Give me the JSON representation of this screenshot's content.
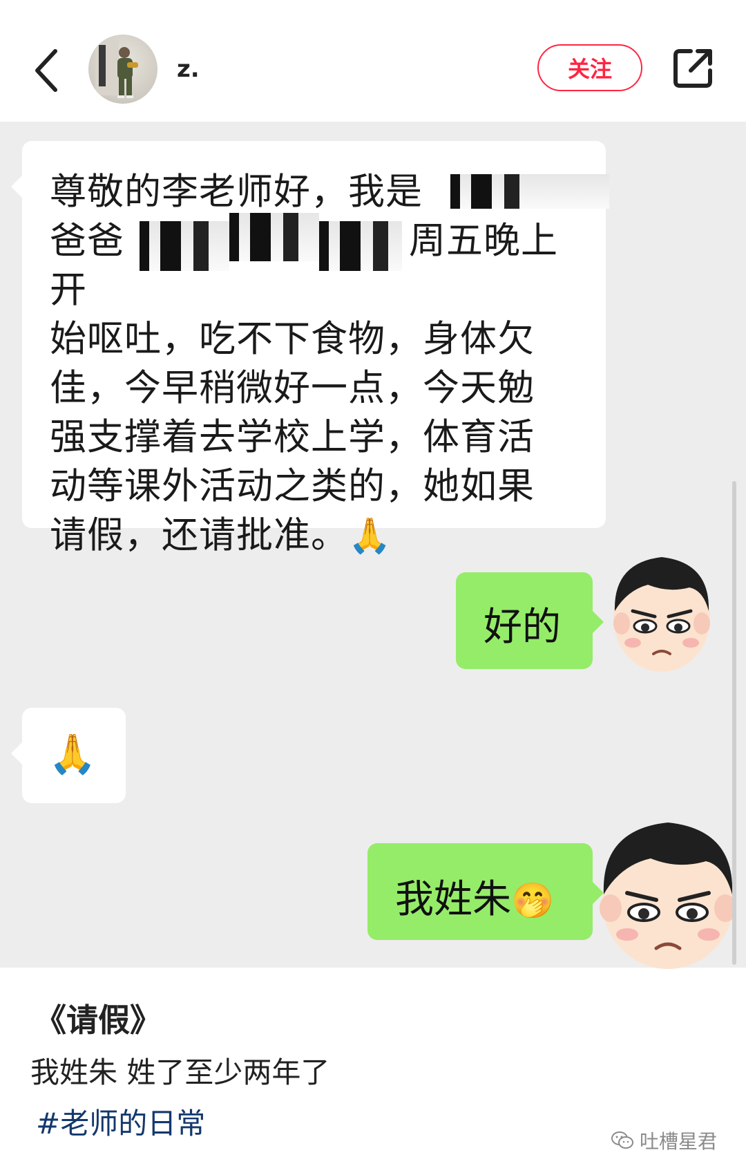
{
  "header": {
    "username": "z.",
    "follow_label": "关注"
  },
  "messages": {
    "m1": {
      "line1": "尊敬的李老师好，我是",
      "line2_prefix": "爸爸",
      "line2_suffix": "周五晚上开",
      "line3": "始呕吐，吃不下食物，身体欠",
      "line4": "佳，今早稍微好一点，今天勉",
      "line5": "强支撑着去学校上学，体育活",
      "line6": "动等课外活动之类的，她如果",
      "line7": "请假，还请批准。",
      "emoji": "🙏"
    },
    "m2": {
      "text": "好的"
    },
    "m3": {
      "emoji": "🙏"
    },
    "m4": {
      "text": "我姓朱",
      "emoji": "🤭"
    }
  },
  "caption": {
    "title": "《请假》",
    "body": "我姓朱 姓了至少两年了",
    "hashtag": "#老师的日常"
  },
  "watermark": {
    "text": "吐槽星君"
  },
  "colors": {
    "follow_red": "#ff2442",
    "bubble_green": "#95ec69",
    "chat_bg": "#ededed",
    "hashtag_blue": "#13386c"
  }
}
